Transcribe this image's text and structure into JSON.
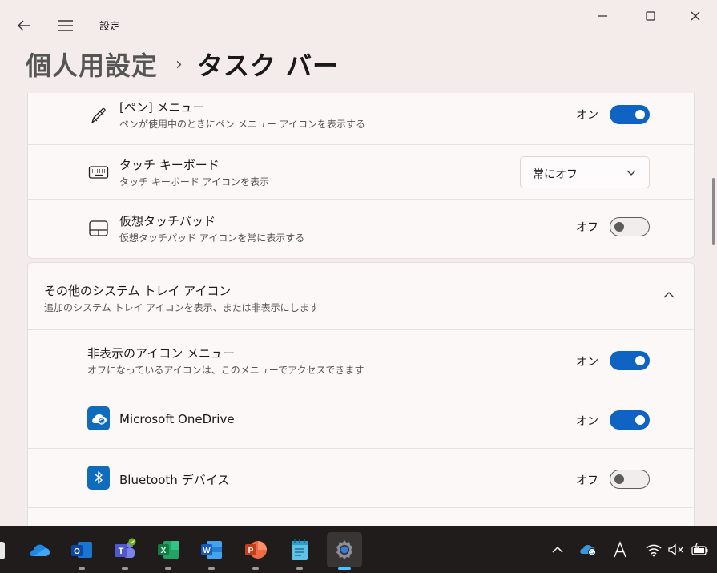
{
  "window": {
    "title": "設定"
  },
  "breadcrumb": {
    "parent": "個人用設定",
    "separator": "›",
    "current": "タスク バー"
  },
  "pen_menu": {
    "title": "[ペン] メニュー",
    "subtitle": "ペンが使用中のときにペン メニュー アイコンを表示する",
    "state": "オン",
    "on": true
  },
  "touch_keyboard": {
    "title": "タッチ キーボード",
    "subtitle": "タッチ キーボード アイコンを表示",
    "value": "常にオフ"
  },
  "virtual_touchpad": {
    "title": "仮想タッチパッド",
    "subtitle": "仮想タッチパッド アイコンを常に表示する",
    "state": "オフ",
    "on": false
  },
  "other_tray": {
    "title": "その他のシステム トレイ アイコン",
    "subtitle": "追加のシステム トレイ アイコンを表示、または非表示にします"
  },
  "hidden_icon_menu": {
    "title": "非表示のアイコン メニュー",
    "subtitle": "オフになっているアイコンは、このメニューでアクセスできます",
    "state": "オン",
    "on": true
  },
  "onedrive": {
    "title": "Microsoft OneDrive",
    "state": "オン",
    "on": true
  },
  "bluetooth": {
    "title": "Bluetooth デバイス",
    "state": "オフ",
    "on": false
  },
  "taskbar": {
    "apps": [
      "onedrive-icon",
      "outlook-icon",
      "teams-icon",
      "excel-icon",
      "word-icon",
      "powerpoint-icon",
      "notepad-icon",
      "settings-icon"
    ],
    "accent": "#4cc2ff"
  },
  "colors": {
    "toggle_on": "#0f63c3",
    "accent": "#0f6cbd"
  }
}
